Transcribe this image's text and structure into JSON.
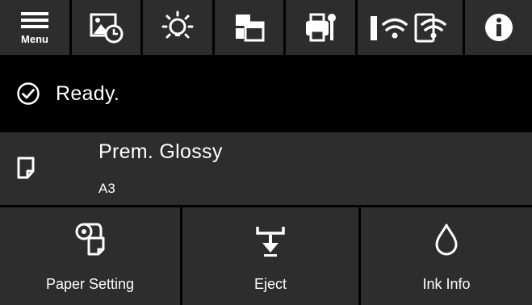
{
  "topbar": {
    "menu_label": "Menu",
    "icons": [
      "menu-icon",
      "maintenance-schedule-icon",
      "brightness-icon",
      "paper-source-icon",
      "printer-settings-icon",
      "network-status-icon",
      "info-icon"
    ]
  },
  "status": {
    "icon": "check-circle-icon",
    "text": "Ready."
  },
  "paper": {
    "icon": "paper-sheet-icon",
    "type": "Prem. Glossy",
    "size": "A3"
  },
  "actions": [
    {
      "icon": "paper-roll-icon",
      "label": "Paper Setting"
    },
    {
      "icon": "eject-icon",
      "label": "Eject"
    },
    {
      "icon": "ink-drop-icon",
      "label": "Ink Info"
    }
  ],
  "colors": {
    "background": "#000000",
    "panel": "#2d2d2d",
    "text": "#ffffff"
  }
}
